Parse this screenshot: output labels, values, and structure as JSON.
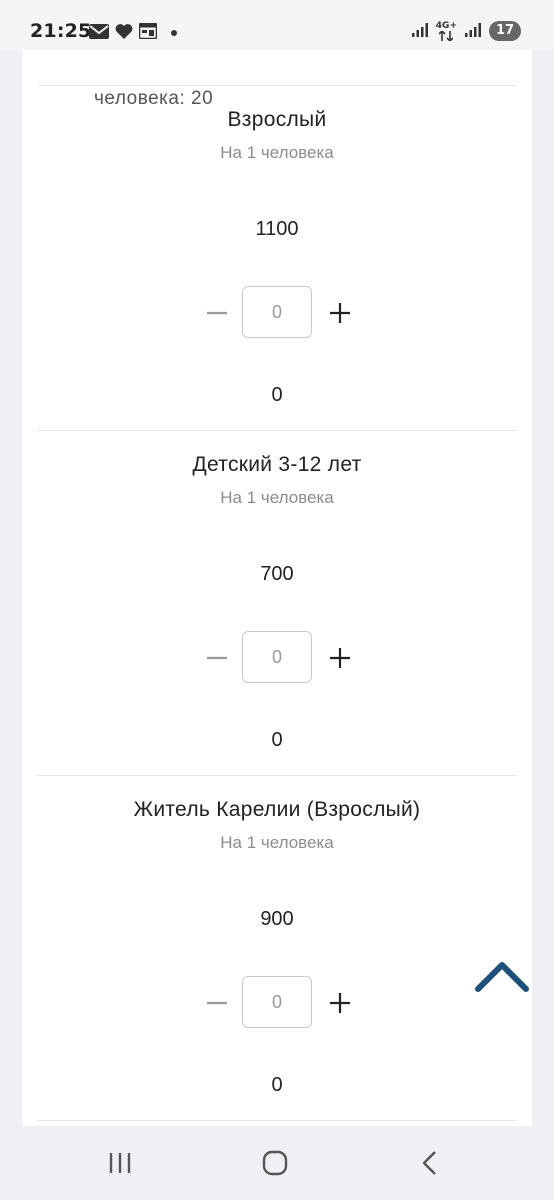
{
  "status_bar": {
    "time": "21:25",
    "left_icons": [
      "mail-icon",
      "heart-icon",
      "calendar-icon",
      "dot-icon"
    ],
    "network_label": "4G+",
    "battery_level": "17"
  },
  "previous_item": {
    "tail_text": "человека: 20"
  },
  "tickets": [
    {
      "title": "Взрослый",
      "subtitle": "На 1 человека",
      "price": "1100",
      "quantity": "0",
      "total": "0"
    },
    {
      "title": "Детский 3-12 лет",
      "subtitle": "На 1 человека",
      "price": "700",
      "quantity": "0",
      "total": "0"
    },
    {
      "title": "Житель Карелии (Взрослый)",
      "subtitle": "На 1 человека",
      "price": "900",
      "quantity": "0",
      "total": "0"
    }
  ],
  "colors": {
    "accent": "#1d4f7a",
    "background": "#eef0f3",
    "card": "#ffffff",
    "muted_text": "#8c8c8c"
  },
  "nav": {
    "icons": [
      "recent-apps-icon",
      "home-icon",
      "back-icon"
    ]
  }
}
